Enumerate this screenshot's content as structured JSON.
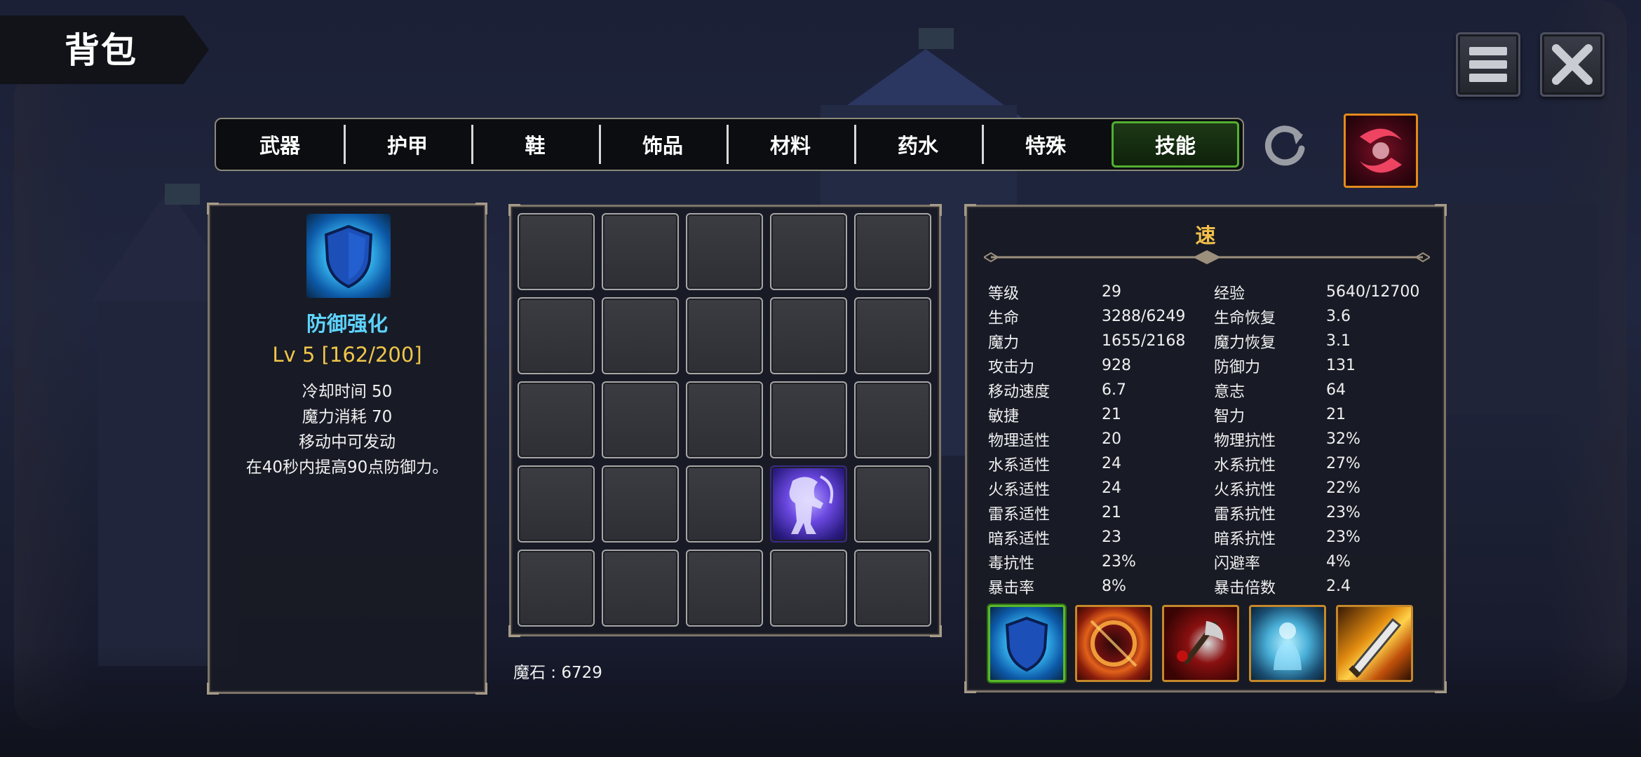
{
  "header": {
    "title": "背包"
  },
  "tabs": [
    {
      "label": "武器",
      "active": false
    },
    {
      "label": "护甲",
      "active": false
    },
    {
      "label": "鞋",
      "active": false
    },
    {
      "label": "饰品",
      "active": false
    },
    {
      "label": "材料",
      "active": false
    },
    {
      "label": "药水",
      "active": false
    },
    {
      "label": "特殊",
      "active": false
    },
    {
      "label": "技能",
      "active": true
    }
  ],
  "toolbar": {
    "menu_icon": "hamburger-menu-icon",
    "close_icon": "close-icon",
    "refresh_icon": "refresh-icon",
    "equipped_skill_icon": "red-slash-skill-icon"
  },
  "selected_skill": {
    "icon": "blue-shield-icon",
    "name": "防御强化",
    "level": "Lv 5 [162/200]",
    "lines": [
      "冷却时间 50",
      "魔力消耗 70",
      "移动中可发动",
      "在40秒内提高90点防御力。"
    ]
  },
  "inventory": {
    "rows": 5,
    "cols": 5,
    "filled_slot_index": 18,
    "filled_slot_icon": "purple-skeleton-reaper-icon",
    "magic_stone": "魔石 : 6729"
  },
  "stats": {
    "title": "速",
    "rows": [
      [
        "等级",
        "29",
        "经验",
        "5640/12700"
      ],
      [
        "生命",
        "3288/6249",
        "生命恢复",
        "3.6"
      ],
      [
        "魔力",
        "1655/2168",
        "魔力恢复",
        "3.1"
      ],
      [
        "攻击力",
        "928",
        "防御力",
        "131"
      ],
      [
        "移动速度",
        "6.7",
        "意志",
        "64"
      ],
      [
        "敏捷",
        "21",
        "智力",
        "21"
      ],
      [
        "物理适性",
        "20",
        "物理抗性",
        "32%"
      ],
      [
        "水系适性",
        "24",
        "水系抗性",
        "27%"
      ],
      [
        "火系适性",
        "24",
        "火系抗性",
        "22%"
      ],
      [
        "雷系适性",
        "21",
        "雷系抗性",
        "23%"
      ],
      [
        "暗系适性",
        "23",
        "暗系抗性",
        "23%"
      ],
      [
        "毒抗性",
        "23%",
        "闪避率",
        "4%"
      ],
      [
        "暴击率",
        "8%",
        "暴击倍数",
        "2.4"
      ]
    ]
  },
  "skill_bar": [
    {
      "icon": "blue-shield-icon",
      "selected": true
    },
    {
      "icon": "fire-ring-icon",
      "selected": false
    },
    {
      "icon": "bloody-axe-icon",
      "selected": false
    },
    {
      "icon": "spirit-aura-icon",
      "selected": false
    },
    {
      "icon": "flaming-blade-icon",
      "selected": false
    }
  ],
  "colors": {
    "skill_name": "#5ed4ff",
    "skill_level": "#f0c64a",
    "stat_title": "#f3c04a",
    "active_tab_border": "#52b030",
    "skill_slot_border": "#c5882a"
  }
}
